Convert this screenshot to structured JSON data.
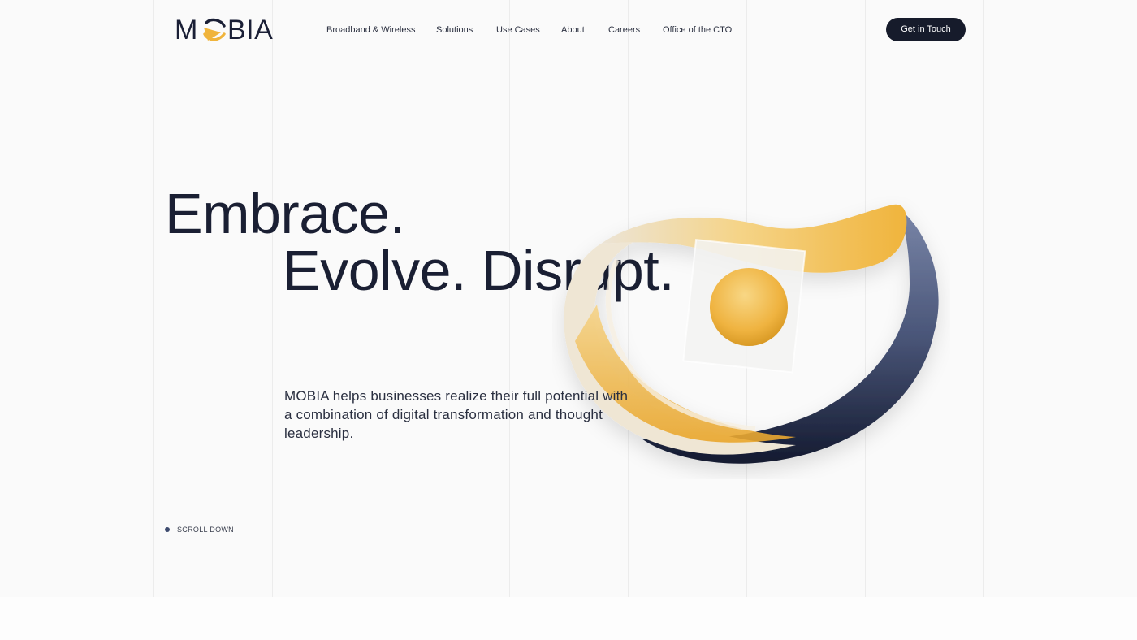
{
  "brand": {
    "logo_prefix": "M",
    "logo_suffix": "BIA",
    "accent_color": "#f0b43c",
    "dark_color": "#161b2b"
  },
  "nav": {
    "items": [
      {
        "label": "Broadband & Wireless"
      },
      {
        "label": "Solutions"
      },
      {
        "label": "Use Cases"
      },
      {
        "label": "About"
      },
      {
        "label": "Careers"
      },
      {
        "label": "Office of the CTO"
      }
    ],
    "cta_label": "Get in Touch"
  },
  "hero": {
    "headline_line1": "Embrace.",
    "headline_line2": "Evolve. Disrupt.",
    "intro": "MOBIA helps businesses realize their full potential with a combination of digital transformation and thought leadership.",
    "scroll_label": "SCROLL DOWN"
  },
  "icons": {
    "logo_mark": "orange-triangle-o",
    "hero_art": "mobius-ribbon-with-sphere",
    "scroll_indicator": "dot-icon"
  }
}
